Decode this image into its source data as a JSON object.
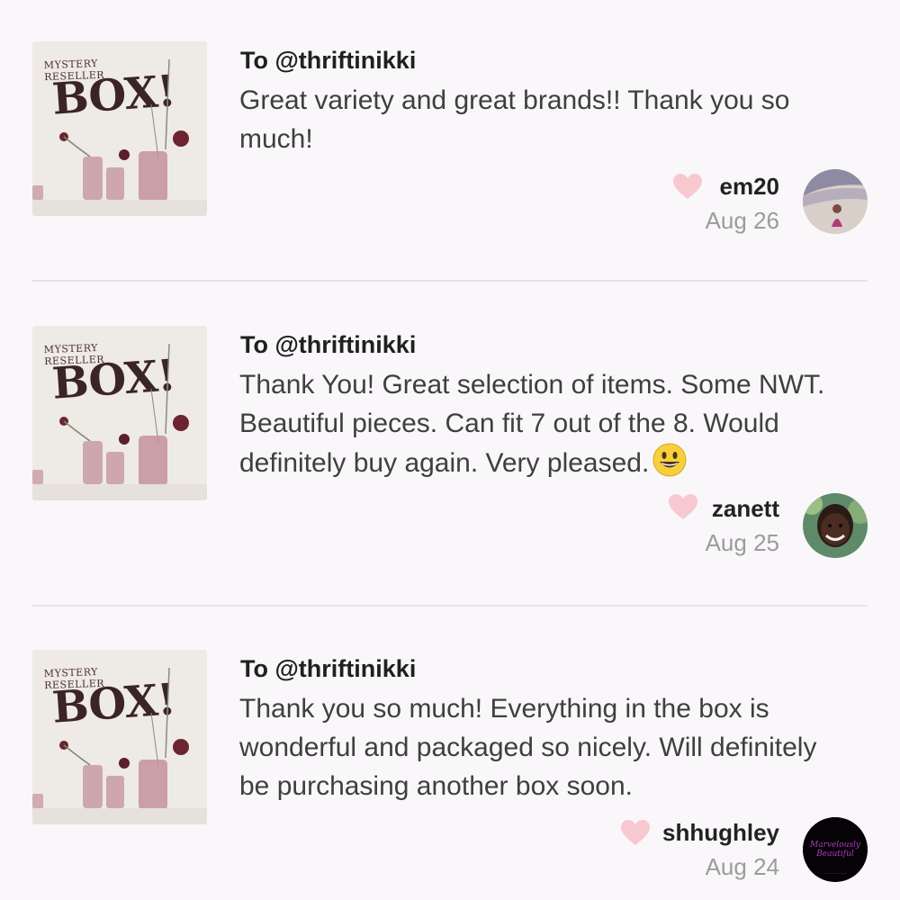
{
  "thumbnail": {
    "title": "MYSTERY RESELLER",
    "word": "BOX!"
  },
  "reviews": [
    {
      "recipient": "To @thriftinikki",
      "text": "Great variety and great brands!! Thank you so much!",
      "username": "em20",
      "date": "Aug 26",
      "avatar_icon": "person-on-beach-avatar",
      "has_emoji": false
    },
    {
      "recipient": "To @thriftinikki",
      "text": "Thank You! Great selection of items. Some NWT. Beautiful pieces. Can fit 7 out of the 8. Would definitely buy again. Very pleased.",
      "username": "zanett",
      "date": "Aug 25",
      "avatar_icon": "smiling-woman-avatar",
      "has_emoji": true,
      "emoji_icon": "grinning-face-emoji"
    },
    {
      "recipient": "To @thriftinikki",
      "text": "Thank you so much! Everything in the box is wonderful and packaged so nicely. Will definitely be purchasing another box soon.",
      "username": "shhughley",
      "date": "Aug 24",
      "avatar_icon": "shop-logo-avatar",
      "avatar_text": "Marvelously Beautiful",
      "has_emoji": false
    }
  ],
  "colors": {
    "heart": "#f8c8d0",
    "background": "#f9f7f9",
    "date": "#9c9c9c"
  }
}
